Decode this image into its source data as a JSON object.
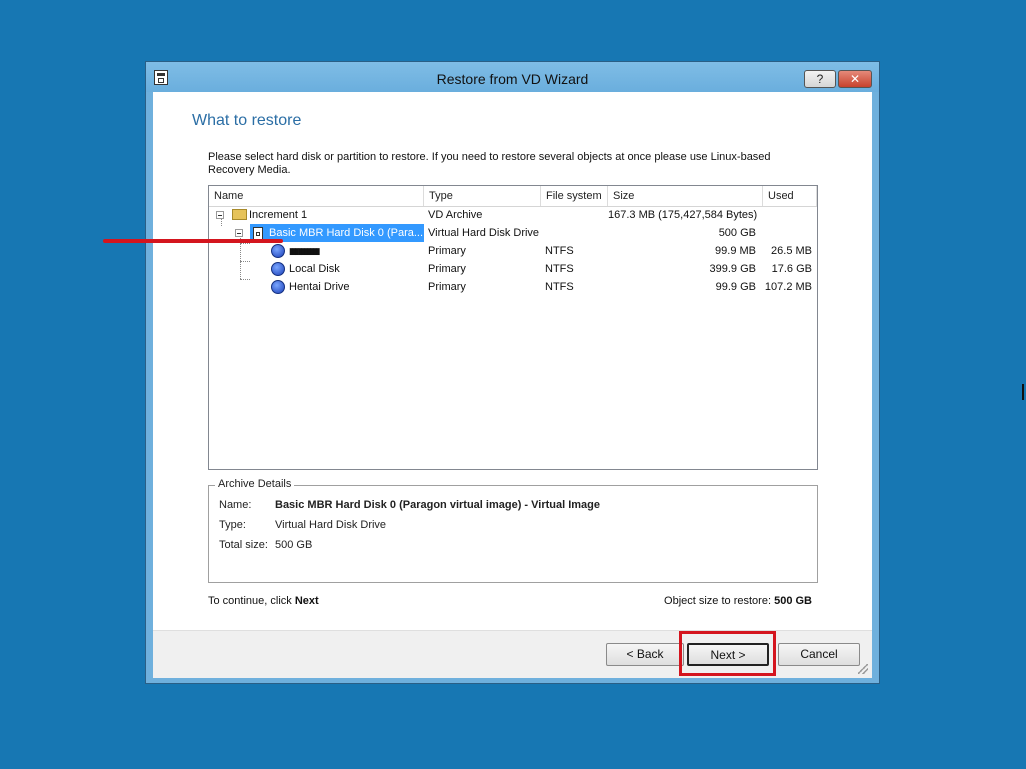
{
  "window": {
    "title": "Restore from VD Wizard",
    "help_label": "?",
    "close_label": "✕"
  },
  "page": {
    "heading": "What to restore",
    "instructions": "Please select hard disk or partition to restore. If you need to restore several objects at once please use Linux-based Recovery Media."
  },
  "table": {
    "columns": [
      "Name",
      "Type",
      "File system",
      "Size",
      "Used"
    ],
    "rows": [
      {
        "name": "Increment 1",
        "type": "VD Archive",
        "fs": "",
        "size": "167.3 MB (175,427,584 Bytes)",
        "used": ""
      },
      {
        "name": "Basic MBR Hard Disk 0 (Para...",
        "type": "Virtual Hard Disk Drive",
        "fs": "",
        "size": "500 GB",
        "used": ""
      },
      {
        "name": "▮▮▮▮▮▮▮▮▮▮",
        "type": "Primary",
        "fs": "NTFS",
        "size": "99.9 MB",
        "used": "26.5 MB"
      },
      {
        "name": "Local Disk",
        "type": "Primary",
        "fs": "NTFS",
        "size": "399.9 GB",
        "used": "17.6 GB"
      },
      {
        "name": "Hentai Drive",
        "type": "Primary",
        "fs": "NTFS",
        "size": "99.9 GB",
        "used": "107.2 MB"
      }
    ]
  },
  "details": {
    "legend": "Archive Details",
    "name_label": "Name:",
    "name_value": "Basic MBR Hard Disk 0 (Paragon virtual image) - Virtual Image",
    "type_label": "Type:",
    "type_value": "Virtual Hard Disk Drive",
    "size_label": "Total size:",
    "size_value": "500 GB"
  },
  "status": {
    "continue_prefix": "To continue, click",
    "continue_bold": "Next",
    "object_prefix": "Object size to restore:",
    "object_value": "500 GB"
  },
  "buttons": {
    "back": "< Back",
    "next": "Next >",
    "cancel": "Cancel"
  },
  "colors": {
    "desktop": "#1777b3",
    "selection": "#3399ff",
    "annotation_red": "#d4151e",
    "heading": "#2b6ea5"
  }
}
